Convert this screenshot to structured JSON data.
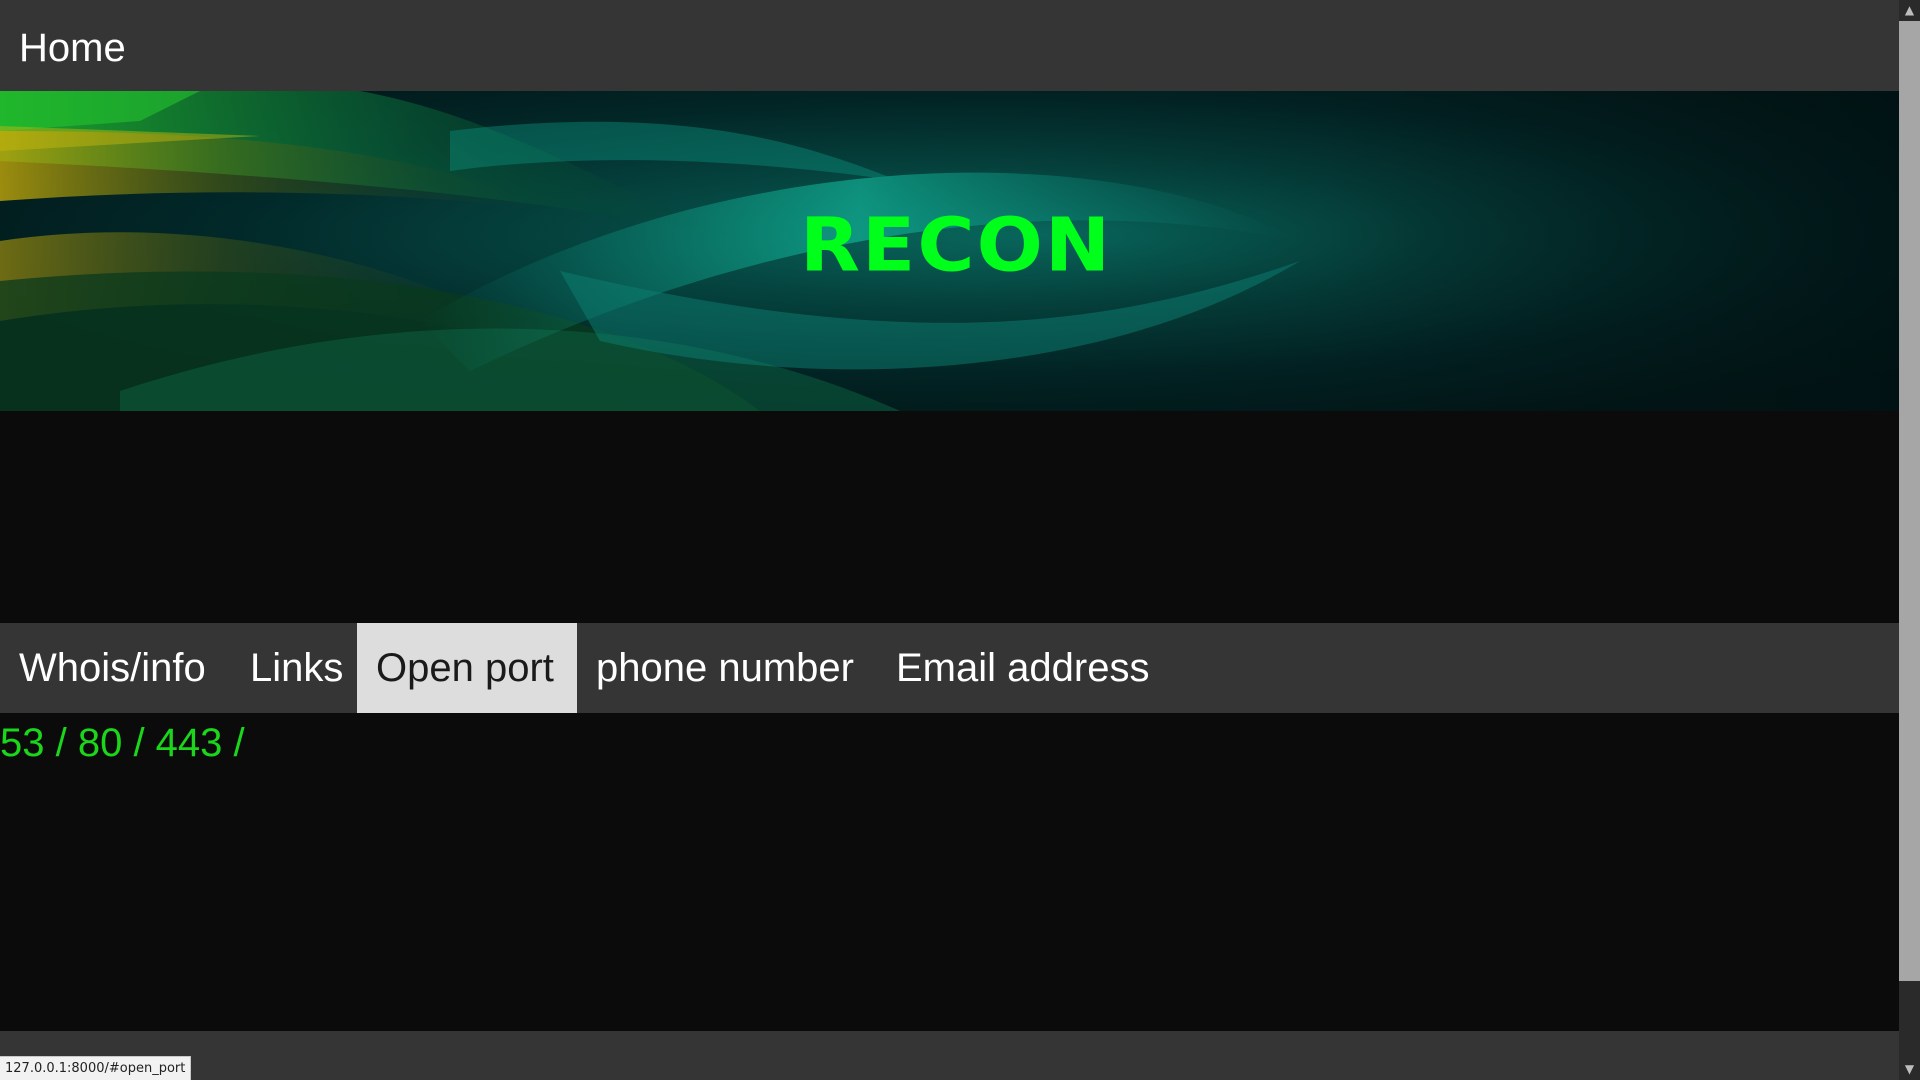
{
  "nav": {
    "home_label": "Home"
  },
  "banner": {
    "logo_text": "RECON"
  },
  "tabs": [
    {
      "label": "Whois/info",
      "active": false
    },
    {
      "label": "Links",
      "active": false
    },
    {
      "label": "Open port",
      "active": true
    },
    {
      "label": "phone number",
      "active": false
    },
    {
      "label": "Email address",
      "active": false
    }
  ],
  "content": {
    "open_ports_text": "53 / 80 / 443 /"
  },
  "status": {
    "url": "127.0.0.1:8000/#open_port"
  },
  "colors": {
    "navbar_bg": "#353535",
    "page_bg": "#0b0b0b",
    "accent_green": "#00ff1a",
    "ports_text": "#1bd61b",
    "active_tab_bg": "#dddddd"
  },
  "icons": {
    "scroll_up": "chevron-up-icon",
    "scroll_down": "chevron-down-icon"
  }
}
